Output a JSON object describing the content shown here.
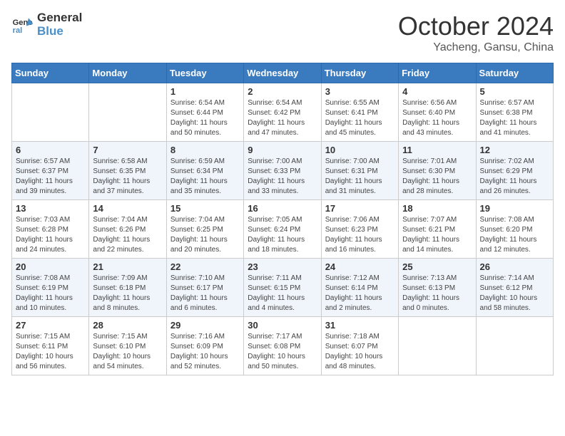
{
  "header": {
    "logo_line1": "General",
    "logo_line2": "Blue",
    "month": "October 2024",
    "location": "Yacheng, Gansu, China"
  },
  "weekdays": [
    "Sunday",
    "Monday",
    "Tuesday",
    "Wednesday",
    "Thursday",
    "Friday",
    "Saturday"
  ],
  "weeks": [
    [
      {
        "day": null
      },
      {
        "day": null
      },
      {
        "day": "1",
        "sunrise": "Sunrise: 6:54 AM",
        "sunset": "Sunset: 6:44 PM",
        "daylight": "Daylight: 11 hours and 50 minutes."
      },
      {
        "day": "2",
        "sunrise": "Sunrise: 6:54 AM",
        "sunset": "Sunset: 6:42 PM",
        "daylight": "Daylight: 11 hours and 47 minutes."
      },
      {
        "day": "3",
        "sunrise": "Sunrise: 6:55 AM",
        "sunset": "Sunset: 6:41 PM",
        "daylight": "Daylight: 11 hours and 45 minutes."
      },
      {
        "day": "4",
        "sunrise": "Sunrise: 6:56 AM",
        "sunset": "Sunset: 6:40 PM",
        "daylight": "Daylight: 11 hours and 43 minutes."
      },
      {
        "day": "5",
        "sunrise": "Sunrise: 6:57 AM",
        "sunset": "Sunset: 6:38 PM",
        "daylight": "Daylight: 11 hours and 41 minutes."
      }
    ],
    [
      {
        "day": "6",
        "sunrise": "Sunrise: 6:57 AM",
        "sunset": "Sunset: 6:37 PM",
        "daylight": "Daylight: 11 hours and 39 minutes."
      },
      {
        "day": "7",
        "sunrise": "Sunrise: 6:58 AM",
        "sunset": "Sunset: 6:35 PM",
        "daylight": "Daylight: 11 hours and 37 minutes."
      },
      {
        "day": "8",
        "sunrise": "Sunrise: 6:59 AM",
        "sunset": "Sunset: 6:34 PM",
        "daylight": "Daylight: 11 hours and 35 minutes."
      },
      {
        "day": "9",
        "sunrise": "Sunrise: 7:00 AM",
        "sunset": "Sunset: 6:33 PM",
        "daylight": "Daylight: 11 hours and 33 minutes."
      },
      {
        "day": "10",
        "sunrise": "Sunrise: 7:00 AM",
        "sunset": "Sunset: 6:31 PM",
        "daylight": "Daylight: 11 hours and 31 minutes."
      },
      {
        "day": "11",
        "sunrise": "Sunrise: 7:01 AM",
        "sunset": "Sunset: 6:30 PM",
        "daylight": "Daylight: 11 hours and 28 minutes."
      },
      {
        "day": "12",
        "sunrise": "Sunrise: 7:02 AM",
        "sunset": "Sunset: 6:29 PM",
        "daylight": "Daylight: 11 hours and 26 minutes."
      }
    ],
    [
      {
        "day": "13",
        "sunrise": "Sunrise: 7:03 AM",
        "sunset": "Sunset: 6:28 PM",
        "daylight": "Daylight: 11 hours and 24 minutes."
      },
      {
        "day": "14",
        "sunrise": "Sunrise: 7:04 AM",
        "sunset": "Sunset: 6:26 PM",
        "daylight": "Daylight: 11 hours and 22 minutes."
      },
      {
        "day": "15",
        "sunrise": "Sunrise: 7:04 AM",
        "sunset": "Sunset: 6:25 PM",
        "daylight": "Daylight: 11 hours and 20 minutes."
      },
      {
        "day": "16",
        "sunrise": "Sunrise: 7:05 AM",
        "sunset": "Sunset: 6:24 PM",
        "daylight": "Daylight: 11 hours and 18 minutes."
      },
      {
        "day": "17",
        "sunrise": "Sunrise: 7:06 AM",
        "sunset": "Sunset: 6:23 PM",
        "daylight": "Daylight: 11 hours and 16 minutes."
      },
      {
        "day": "18",
        "sunrise": "Sunrise: 7:07 AM",
        "sunset": "Sunset: 6:21 PM",
        "daylight": "Daylight: 11 hours and 14 minutes."
      },
      {
        "day": "19",
        "sunrise": "Sunrise: 7:08 AM",
        "sunset": "Sunset: 6:20 PM",
        "daylight": "Daylight: 11 hours and 12 minutes."
      }
    ],
    [
      {
        "day": "20",
        "sunrise": "Sunrise: 7:08 AM",
        "sunset": "Sunset: 6:19 PM",
        "daylight": "Daylight: 11 hours and 10 minutes."
      },
      {
        "day": "21",
        "sunrise": "Sunrise: 7:09 AM",
        "sunset": "Sunset: 6:18 PM",
        "daylight": "Daylight: 11 hours and 8 minutes."
      },
      {
        "day": "22",
        "sunrise": "Sunrise: 7:10 AM",
        "sunset": "Sunset: 6:17 PM",
        "daylight": "Daylight: 11 hours and 6 minutes."
      },
      {
        "day": "23",
        "sunrise": "Sunrise: 7:11 AM",
        "sunset": "Sunset: 6:15 PM",
        "daylight": "Daylight: 11 hours and 4 minutes."
      },
      {
        "day": "24",
        "sunrise": "Sunrise: 7:12 AM",
        "sunset": "Sunset: 6:14 PM",
        "daylight": "Daylight: 11 hours and 2 minutes."
      },
      {
        "day": "25",
        "sunrise": "Sunrise: 7:13 AM",
        "sunset": "Sunset: 6:13 PM",
        "daylight": "Daylight: 11 hours and 0 minutes."
      },
      {
        "day": "26",
        "sunrise": "Sunrise: 7:14 AM",
        "sunset": "Sunset: 6:12 PM",
        "daylight": "Daylight: 10 hours and 58 minutes."
      }
    ],
    [
      {
        "day": "27",
        "sunrise": "Sunrise: 7:15 AM",
        "sunset": "Sunset: 6:11 PM",
        "daylight": "Daylight: 10 hours and 56 minutes."
      },
      {
        "day": "28",
        "sunrise": "Sunrise: 7:15 AM",
        "sunset": "Sunset: 6:10 PM",
        "daylight": "Daylight: 10 hours and 54 minutes."
      },
      {
        "day": "29",
        "sunrise": "Sunrise: 7:16 AM",
        "sunset": "Sunset: 6:09 PM",
        "daylight": "Daylight: 10 hours and 52 minutes."
      },
      {
        "day": "30",
        "sunrise": "Sunrise: 7:17 AM",
        "sunset": "Sunset: 6:08 PM",
        "daylight": "Daylight: 10 hours and 50 minutes."
      },
      {
        "day": "31",
        "sunrise": "Sunrise: 7:18 AM",
        "sunset": "Sunset: 6:07 PM",
        "daylight": "Daylight: 10 hours and 48 minutes."
      },
      {
        "day": null
      },
      {
        "day": null
      }
    ]
  ]
}
